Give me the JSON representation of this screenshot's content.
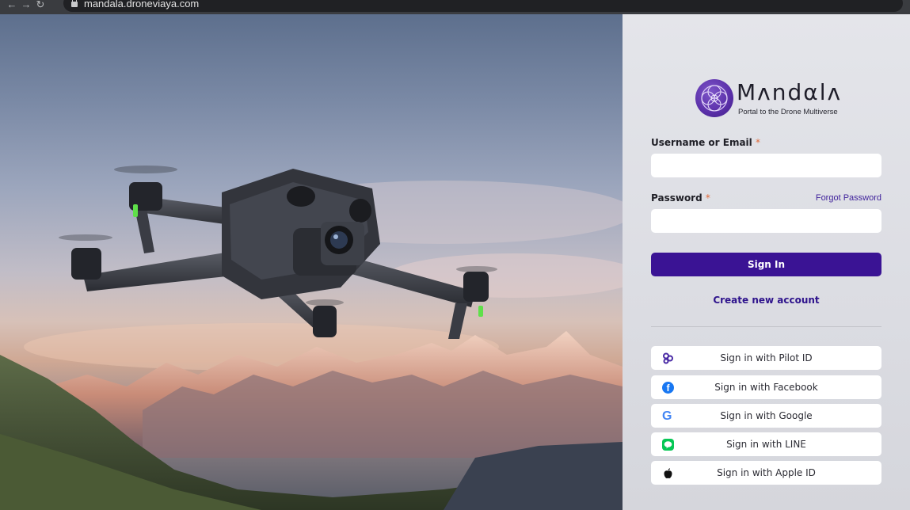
{
  "browser": {
    "url": "mandala.droneviaya.com"
  },
  "logo": {
    "title": "Mʌndαlʌ",
    "tagline": "Portal to the Drone Multiverse"
  },
  "form": {
    "username_label": "Username or Email",
    "password_label": "Password",
    "required_mark": "*",
    "forgot_password": "Forgot Password",
    "username_value": "",
    "password_value": "",
    "sign_in": "Sign In",
    "create_account": "Create new account"
  },
  "social": [
    {
      "label": "Sign in with Pilot ID",
      "icon": "pilot-id-icon"
    },
    {
      "label": "Sign in with Facebook",
      "icon": "facebook-icon"
    },
    {
      "label": "Sign in with Google",
      "icon": "google-icon"
    },
    {
      "label": "Sign in with LINE",
      "icon": "line-icon"
    },
    {
      "label": "Sign in with Apple ID",
      "icon": "apple-icon"
    }
  ],
  "colors": {
    "primary": "#3a1394",
    "link": "#3d1f9a",
    "required": "#e06a3a",
    "facebook": "#1877f2",
    "line": "#06c755"
  }
}
